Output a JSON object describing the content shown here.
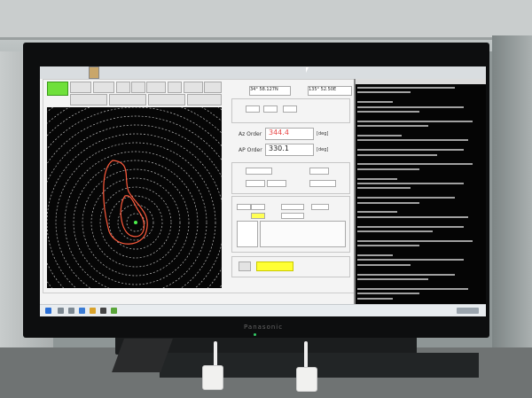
{
  "photo": {
    "monitor_brand": "Panasonic"
  },
  "app": {
    "position": {
      "lat": "34° 58.127N",
      "lon": "135° 52.50E"
    },
    "az": {
      "label": "Az Order",
      "value": "344.4",
      "unit": "[deg]"
    },
    "ap": {
      "label": "AP Order",
      "value": "330.1",
      "unit": "[deg]"
    },
    "yellow_button": "Yellow button"
  },
  "terminal": {
    "lines_count_note": ""
  },
  "colors": {
    "app_green": "#6fe03a",
    "az_value": "#e84848",
    "contour": "#ff5a3c",
    "yellow": "#ffff33"
  }
}
